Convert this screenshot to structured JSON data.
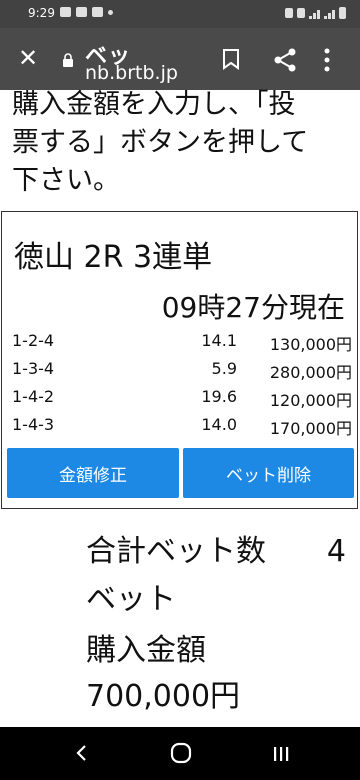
{
  "status_bar": {
    "time": "9:29"
  },
  "toolbar": {
    "close_icon": "close-icon",
    "title": "ベッ",
    "url": "nb.brtb.jp"
  },
  "intro_text": "購入金額を入力し、「投\n票する」ボタンを押して\n下さい。",
  "card": {
    "race": "徳山 2R 3連単",
    "as_of": "09時27分現在",
    "bets": [
      {
        "combo": "1-2-4",
        "odds": "14.1",
        "amount": "130,000円"
      },
      {
        "combo": "1-3-4",
        "odds": "5.9",
        "amount": "280,000円"
      },
      {
        "combo": "1-4-2",
        "odds": "19.6",
        "amount": "120,000円"
      },
      {
        "combo": "1-4-3",
        "odds": "14.0",
        "amount": "170,000円"
      }
    ],
    "edit_button": "金額修正",
    "delete_button": "ベット削除"
  },
  "summary": {
    "total_label": "合計ベット数",
    "total_count": "4",
    "total_unit": "ベット",
    "purchase_label": "購入金額",
    "purchase_amount": "700,000円"
  },
  "colors": {
    "button": "#1e88e5",
    "toolbar": "#4a4a4a",
    "status_bar": "#424242"
  }
}
